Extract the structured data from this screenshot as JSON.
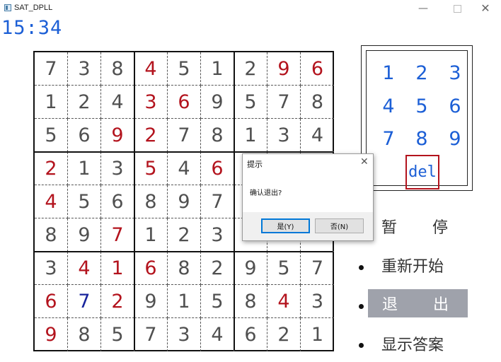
{
  "window": {
    "title": "SAT_DPLL",
    "min_glyph": "—",
    "close_glyph": "✕"
  },
  "timer": "15:34",
  "board": {
    "rows": [
      [
        "7",
        "3",
        "8",
        "4",
        "5",
        "1",
        "2",
        "9",
        "6"
      ],
      [
        "1",
        "2",
        "4",
        "3",
        "6",
        "9",
        "5",
        "7",
        "8"
      ],
      [
        "5",
        "6",
        "9",
        "2",
        "7",
        "8",
        "1",
        "3",
        "4"
      ],
      [
        "2",
        "1",
        "3",
        "5",
        "4",
        "6",
        "",
        "",
        ""
      ],
      [
        "4",
        "5",
        "6",
        "8",
        "9",
        "7",
        "",
        "",
        ""
      ],
      [
        "8",
        "9",
        "7",
        "1",
        "2",
        "3",
        "",
        "",
        ""
      ],
      [
        "3",
        "4",
        "1",
        "6",
        "8",
        "2",
        "9",
        "5",
        "7"
      ],
      [
        "6",
        "7",
        "2",
        "9",
        "1",
        "5",
        "8",
        "4",
        "3"
      ],
      [
        "9",
        "8",
        "5",
        "7",
        "3",
        "4",
        "6",
        "2",
        "1"
      ]
    ],
    "colors": [
      [
        "k",
        "k",
        "k",
        "r",
        "k",
        "k",
        "k",
        "r",
        "r"
      ],
      [
        "k",
        "k",
        "k",
        "r",
        "r",
        "k",
        "k",
        "k",
        "k"
      ],
      [
        "k",
        "k",
        "r",
        "r",
        "k",
        "k",
        "k",
        "k",
        "k"
      ],
      [
        "r",
        "k",
        "k",
        "r",
        "k",
        "r",
        "k",
        "k",
        "k"
      ],
      [
        "r",
        "k",
        "k",
        "k",
        "k",
        "k",
        "k",
        "k",
        "k"
      ],
      [
        "k",
        "k",
        "r",
        "k",
        "k",
        "k",
        "k",
        "k",
        "k"
      ],
      [
        "k",
        "r",
        "r",
        "r",
        "k",
        "k",
        "k",
        "k",
        "k"
      ],
      [
        "r",
        "b",
        "r",
        "k",
        "k",
        "k",
        "k",
        "r",
        "k"
      ],
      [
        "r",
        "k",
        "k",
        "k",
        "k",
        "k",
        "k",
        "k",
        "k"
      ]
    ],
    "color_map": {
      "k": "#505050",
      "r": "#b3131d",
      "b": "#18249c"
    }
  },
  "numpad": {
    "keys": [
      "1",
      "2",
      "3",
      "4",
      "5",
      "6",
      "7",
      "8",
      "9"
    ],
    "del_label": "del"
  },
  "menu": {
    "pause_left": "暂",
    "pause_right": "停",
    "restart": "重新开始",
    "exit_left": "退",
    "exit_right": "出",
    "show_answer": "显示答案"
  },
  "dialog": {
    "title": "提示",
    "close_glyph": "✕",
    "message": "确认退出?",
    "yes_label": "是(Y)",
    "no_label": "否(N)"
  }
}
